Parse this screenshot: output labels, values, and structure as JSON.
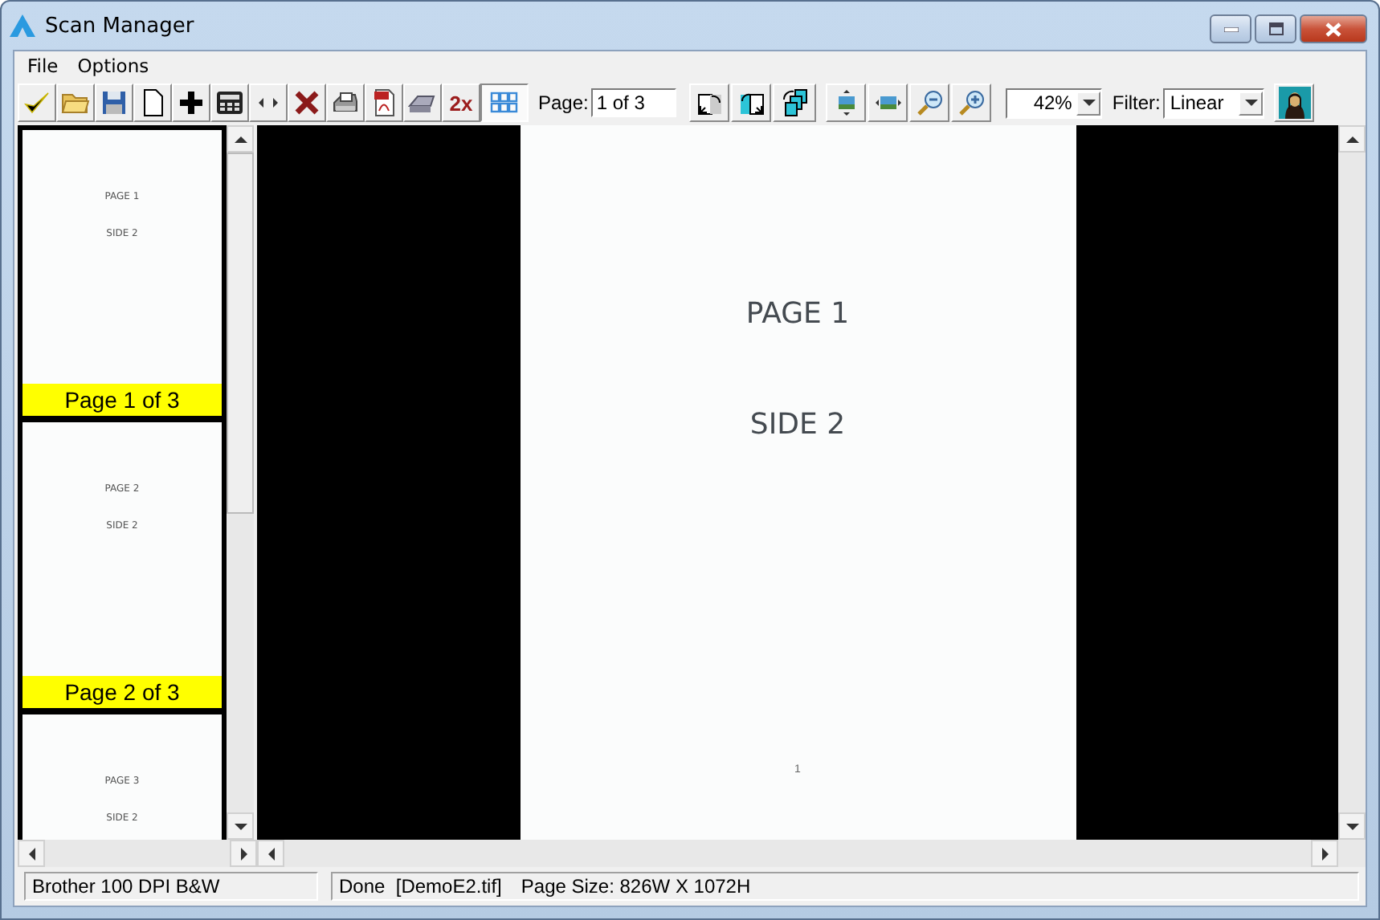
{
  "window": {
    "title": "Scan Manager"
  },
  "menu": [
    "File",
    "Options"
  ],
  "toolbar": [
    {
      "kind": "accept",
      "selected": false
    },
    {
      "kind": "open",
      "selected": false
    },
    {
      "kind": "save",
      "selected": false
    },
    {
      "kind": "new",
      "selected": false
    },
    {
      "kind": "add",
      "selected": false
    },
    {
      "kind": "calculator",
      "selected": false
    },
    {
      "kind": "swap",
      "selected": false
    },
    {
      "kind": "delete",
      "selected": false
    },
    {
      "kind": "print",
      "selected": false
    },
    {
      "kind": "pdf",
      "selected": false
    },
    {
      "kind": "scan",
      "selected": false
    },
    {
      "kind": "double",
      "text": "2x",
      "selected": false
    },
    {
      "kind": "grid",
      "selected": true
    }
  ],
  "page_field": {
    "label": "Page:",
    "value": "1 of 3"
  },
  "view_tools": [
    {
      "kind": "rotate-left"
    },
    {
      "kind": "rotate-right"
    },
    {
      "kind": "rotate-page"
    },
    {
      "kind": "fit-height"
    },
    {
      "kind": "fit-width"
    },
    {
      "kind": "zoom-out"
    },
    {
      "kind": "zoom-in"
    }
  ],
  "zoom": {
    "value": "42%"
  },
  "filter": {
    "label": "Filter:",
    "value": "Linear"
  },
  "thumbnails": [
    {
      "lines": [
        "PAGE 1",
        "SIDE 2"
      ],
      "label": "Page 1 of 3"
    },
    {
      "lines": [
        "PAGE 2",
        "SIDE 2"
      ],
      "label": "Page 2 of 3"
    },
    {
      "lines": [
        "PAGE 3",
        "SIDE 2"
      ]
    }
  ],
  "page_view": {
    "lines": [
      "PAGE 1",
      "SIDE 2"
    ],
    "footer": "1"
  },
  "status_bar": {
    "scanner": "Brother 100 DPI B&W",
    "status": "Done  [DemoE2.tif]",
    "page_size": "Page Size: 826W X 1072H"
  }
}
